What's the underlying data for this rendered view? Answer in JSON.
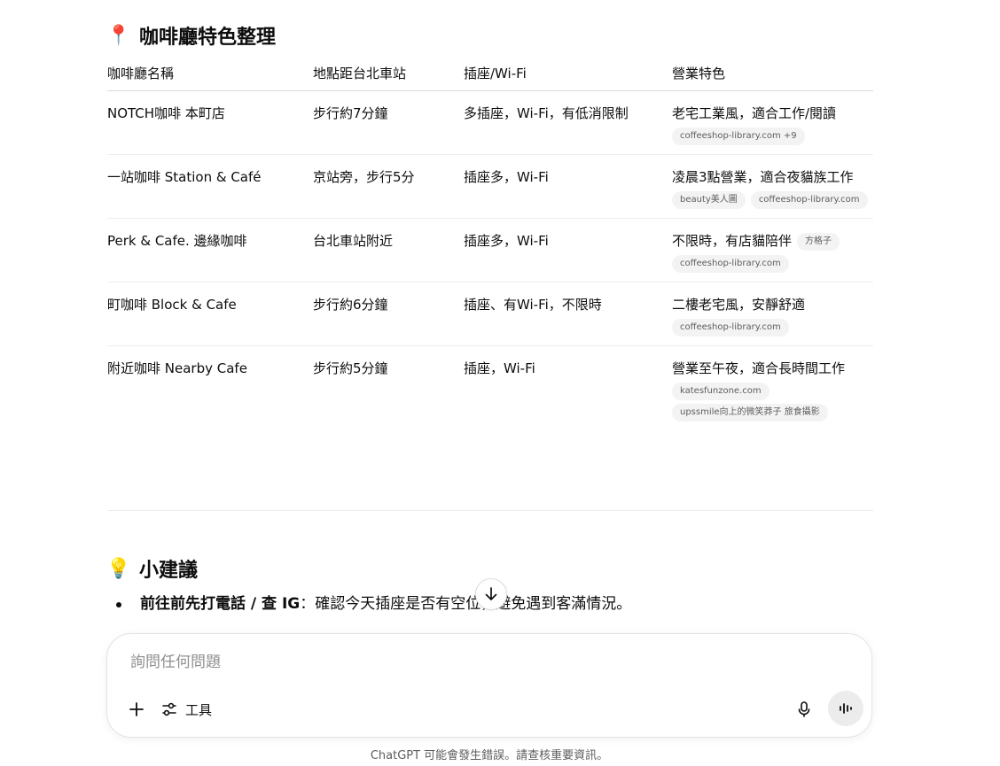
{
  "section1": {
    "emoji": "📍",
    "title": "咖啡廳特色整理"
  },
  "table": {
    "headers": [
      "咖啡廳名稱",
      "地點距台北車站",
      "插座/Wi-Fi",
      "營業特色"
    ],
    "rows": [
      {
        "name": "NOTCH咖啡 本町店",
        "distance": "步行約7分鐘",
        "wifi": "多插座，Wi-Fi，有低消限制",
        "feature": "老宅工業風，適合工作/閱讀",
        "inline_source": "",
        "sources": [
          "coffeeshop-library.com +9"
        ]
      },
      {
        "name": "一站咖啡 Station & Café",
        "distance": "京站旁，步行5分",
        "wifi": "插座多，Wi-Fi",
        "feature": "凌晨3點營業，適合夜貓族工作",
        "inline_source": "",
        "sources": [
          "beauty美人圖",
          "coffeeshop-library.com"
        ]
      },
      {
        "name": "Perk & Cafe. 邊緣咖啡",
        "distance": "台北車站附近",
        "wifi": "插座多，Wi-Fi",
        "feature": "不限時，有店貓陪伴",
        "inline_source": "方格子",
        "sources": [
          "coffeeshop-library.com"
        ]
      },
      {
        "name": "町咖啡 Block & Cafe",
        "distance": "步行約6分鐘",
        "wifi": "插座、有Wi-Fi，不限時",
        "feature": "二樓老宅風，安靜舒適",
        "inline_source": "",
        "sources": [
          "coffeeshop-library.com"
        ]
      },
      {
        "name": "附近咖啡 Nearby Cafe",
        "distance": "步行約5分鐘",
        "wifi": "插座，Wi-Fi",
        "feature": "營業至午夜，適合長時間工作",
        "inline_source": "",
        "sources": [
          "katesfunzone.com",
          "upssmile向上的微笑莽子 旅食攝影"
        ]
      }
    ]
  },
  "section2": {
    "emoji": "💡",
    "title": "小建議"
  },
  "tips": [
    {
      "bold": "前往前先打電話 / 查 IG",
      "text": "：確認今天插座是否有空位，避免遇到客滿情況。"
    }
  ],
  "composer": {
    "placeholder": "詢問任何問題",
    "tools_label": "工具"
  },
  "footer": {
    "disclaimer": "ChatGPT 可能會發生錯誤。請查核重要資訊。"
  },
  "icons": {
    "scroll": "arrow-down-icon",
    "plus": "plus-icon",
    "tools": "sliders-icon",
    "mic": "microphone-icon",
    "voice": "voice-waveform-icon"
  }
}
